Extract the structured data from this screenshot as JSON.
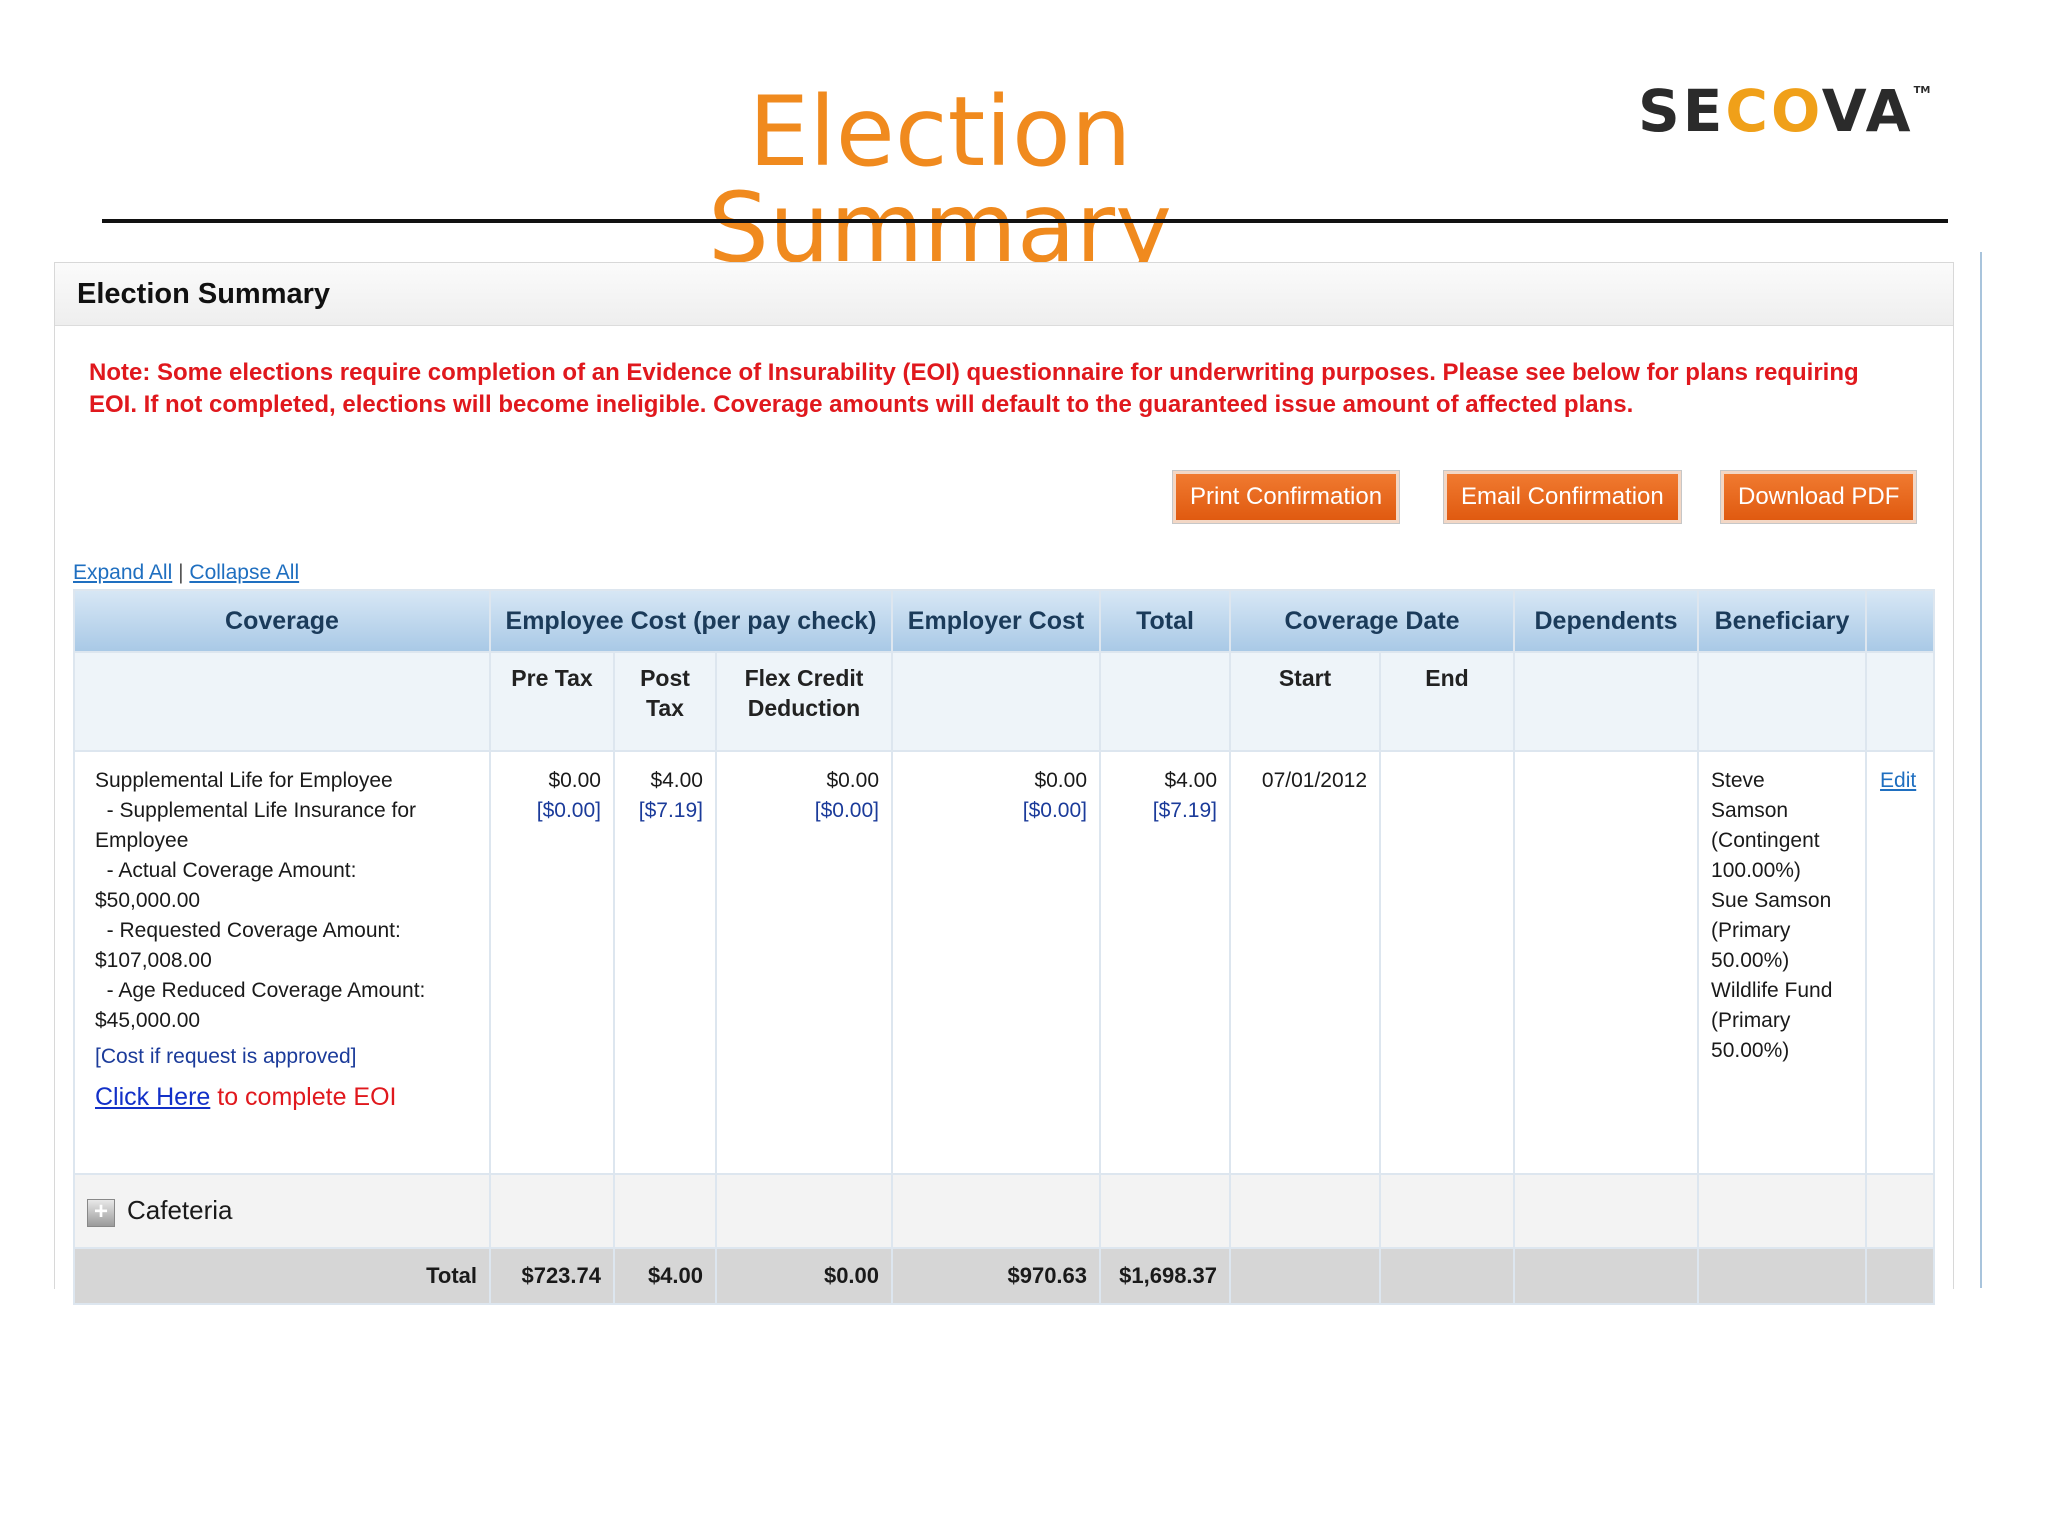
{
  "slide": {
    "title": "Election Summary",
    "logo": {
      "part1": "SE",
      "accent": "CO",
      "part2": "VA",
      "tm": "TM"
    }
  },
  "panel": {
    "header": "Election Summary",
    "note": "Note: Some elections require completion of an Evidence of Insurability (EOI) questionnaire for underwriting purposes. Please see below for plans requiring EOI. If not completed, elections will become ineligible. Coverage amounts will default to the guaranteed issue amount of affected plans.",
    "buttons": {
      "print": "Print Confirmation",
      "email": "Email Confirmation",
      "pdf": "Download PDF"
    },
    "links": {
      "expand": "Expand All",
      "separator": "|",
      "collapse": "Collapse All"
    }
  },
  "table": {
    "headers": {
      "coverage": "Coverage",
      "employee_cost": "Employee Cost (per pay check)",
      "employer_cost": "Employer Cost",
      "total": "Total",
      "coverage_date": "Coverage Date",
      "dependents": "Dependents",
      "beneficiary": "Beneficiary"
    },
    "subheaders": {
      "pre_tax": "Pre Tax",
      "post_tax_1": "Post",
      "post_tax_2": "Tax",
      "flex_1": "Flex Credit",
      "flex_2": "Deduction",
      "start": "Start",
      "end": "End"
    },
    "row": {
      "lines": [
        "Supplemental Life for Employee",
        "  - Supplemental Life Insurance for",
        "Employee",
        "  - Actual Coverage Amount:",
        "$50,000.00",
        "  - Requested Coverage Amount:",
        "$107,008.00",
        "  - Age Reduced Coverage Amount:",
        "$45,000.00"
      ],
      "cost_note": "[Cost if request is approved]",
      "eoi_link": "Click Here",
      "eoi_text": " to complete EOI",
      "pre_tax": "$0.00",
      "pre_tax_req": "[$0.00]",
      "post_tax": "$4.00",
      "post_tax_req": "[$7.19]",
      "flex": "$0.00",
      "flex_req": "[$0.00]",
      "employer": "$0.00",
      "employer_req": "[$0.00]",
      "total": "$4.00",
      "total_req": "[$7.19]",
      "start": "07/01/2012",
      "end": "",
      "dependents": "",
      "beneficiary": [
        "Steve",
        "Samson",
        "(Contingent",
        "100.00%)",
        "Sue Samson",
        "(Primary",
        "50.00%)",
        "Wildlife Fund",
        "(Primary",
        "50.00%)"
      ],
      "edit": "Edit"
    },
    "cafeteria": {
      "expander": "+",
      "label": "Cafeteria"
    },
    "totals": {
      "label": "Total",
      "pre_tax": "$723.74",
      "post_tax": "$4.00",
      "flex": "$0.00",
      "employer": "$970.63",
      "total": "$1,698.37"
    }
  }
}
